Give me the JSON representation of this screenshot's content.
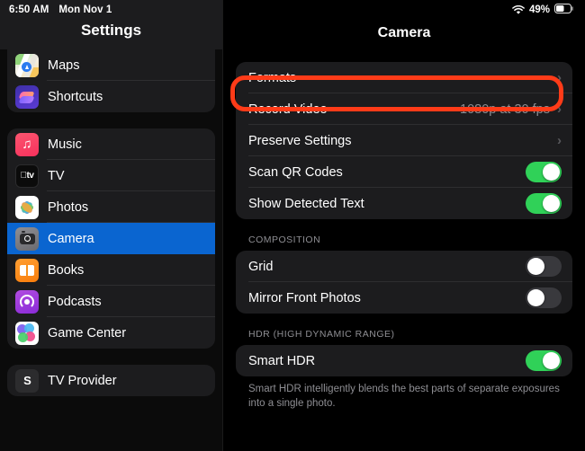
{
  "status_bar": {
    "time": "6:50 AM",
    "date": "Mon Nov 1",
    "wifi_icon": "wifi-icon",
    "battery_percent": "49%",
    "battery_icon": "battery-icon"
  },
  "sidebar": {
    "title": "Settings",
    "groups": [
      {
        "items": [
          {
            "label": "Maps",
            "icon": "maps-app-icon",
            "selected": false
          },
          {
            "label": "Shortcuts",
            "icon": "shortcuts-app-icon",
            "selected": false
          }
        ]
      },
      {
        "items": [
          {
            "label": "Music",
            "icon": "music-app-icon",
            "selected": false
          },
          {
            "label": "TV",
            "icon": "tv-app-icon",
            "selected": false
          },
          {
            "label": "Photos",
            "icon": "photos-app-icon",
            "selected": false
          },
          {
            "label": "Camera",
            "icon": "camera-app-icon",
            "selected": true
          },
          {
            "label": "Books",
            "icon": "books-app-icon",
            "selected": false
          },
          {
            "label": "Podcasts",
            "icon": "podcasts-app-icon",
            "selected": false
          },
          {
            "label": "Game Center",
            "icon": "game-center-app-icon",
            "selected": false
          }
        ]
      },
      {
        "items": [
          {
            "label": "TV Provider",
            "icon": "tv-provider-icon",
            "selected": false
          }
        ]
      }
    ]
  },
  "detail": {
    "title": "Camera",
    "groups": [
      {
        "header": "",
        "footer": "",
        "rows": [
          {
            "label": "Formats",
            "type": "disclosure",
            "value": "",
            "chevron": "›"
          },
          {
            "label": "Record Video",
            "type": "disclosure",
            "value": "1080p at 30 fps",
            "chevron": "›"
          },
          {
            "label": "Preserve Settings",
            "type": "disclosure",
            "value": "",
            "chevron": "›"
          },
          {
            "label": "Scan QR Codes",
            "type": "toggle",
            "state": "on",
            "highlighted": true
          },
          {
            "label": "Show Detected Text",
            "type": "toggle",
            "state": "on",
            "highlighted": false
          }
        ]
      },
      {
        "header": "COMPOSITION",
        "footer": "",
        "rows": [
          {
            "label": "Grid",
            "type": "toggle",
            "state": "off",
            "highlighted": false
          },
          {
            "label": "Mirror Front Photos",
            "type": "toggle",
            "state": "off",
            "highlighted": false
          }
        ]
      },
      {
        "header": "HDR (HIGH DYNAMIC RANGE)",
        "footer": "Smart HDR intelligently blends the best parts of separate exposures into a single photo.",
        "rows": [
          {
            "label": "Smart HDR",
            "type": "toggle",
            "state": "on",
            "highlighted": false
          }
        ]
      }
    ]
  },
  "annotation": {
    "shape": "rounded-rectangle",
    "color": "#ff3b18",
    "target": "Scan QR Codes"
  },
  "colors": {
    "selection_blue": "#0a65d0",
    "toggle_on_green": "#30d158",
    "toggle_off_gray": "#39393d",
    "card_background": "#1c1c1e",
    "secondary_text": "#8e8e93"
  }
}
